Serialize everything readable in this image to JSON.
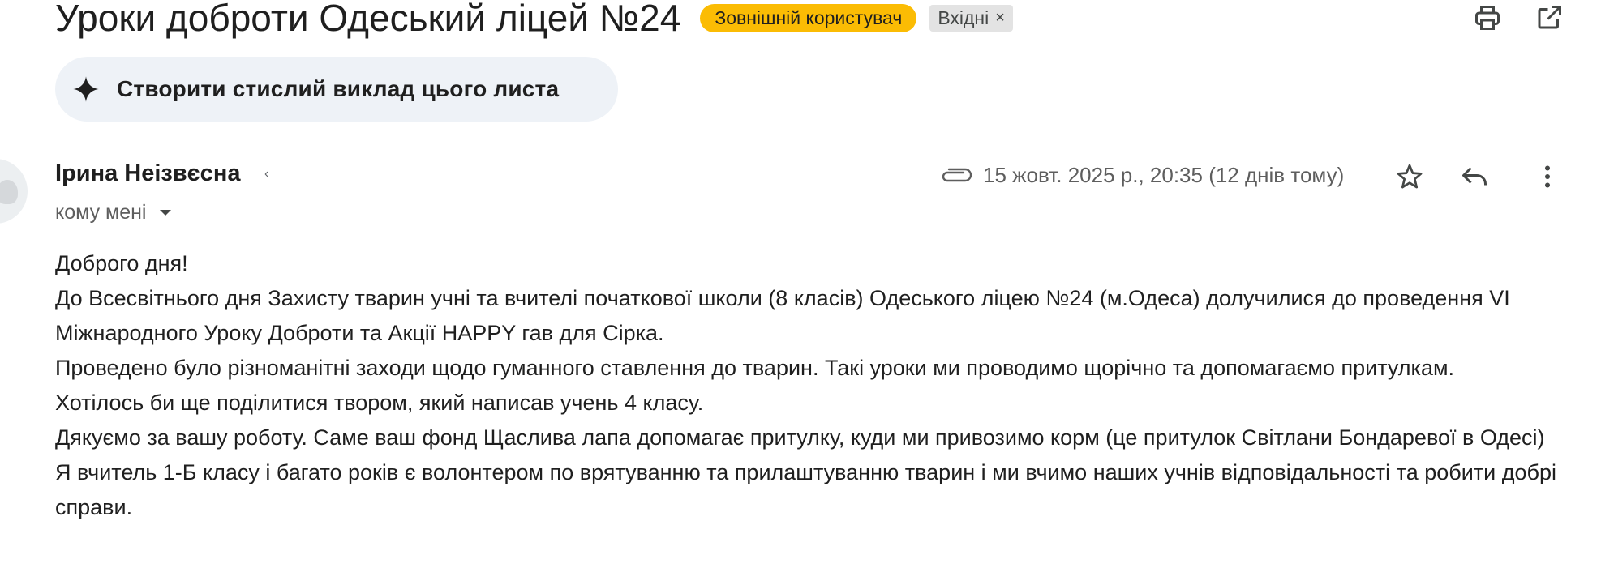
{
  "email": {
    "subject": "Уроки доброти Одеський ліцей №24",
    "external_badge": "Зовнішній користувач",
    "label_chip": "Вхідні",
    "label_chip_remove": "×",
    "summary_button_label": "Створити стислий виклад цього листа",
    "sender_name": "Ірина Неізвєсна",
    "sender_caret": "‹",
    "recipient_label": "кому мені",
    "date_text": "15 жовт. 2025 р., 20:35 (12 днів тому)",
    "body_paragraphs": [
      "Доброго дня!",
      "До Всесвітнього дня Захисту тварин учні та вчителі початкової школи (8 класів) Одеського ліцею №24 (м.Одеса)  долучилися до проведення VI Міжнародного Уроку Доброти та Акції HAPPY гав для Сірка.",
      "Проведено було різноманітні заходи щодо гуманного ставлення до тварин. Такі уроки ми проводимо щорічно та допомагаємо притулкам.",
      "Хотілось би ще поділитися твором, який написав учень 4 класу.",
      "Дякуємо за вашу роботу. Саме ваш фонд Щаслива лапа допомагає притулку, куди ми привозимо корм (це притулок Світлани Бондаревої в Одесі)",
      "Я вчитель 1-Б класу і  багато років є волонтером по врятуванню та прилаштуванню тварин і ми вчимо наших учнів відповідальності та робити добрі справи."
    ]
  },
  "icons": {
    "print": "print-icon",
    "open_new_window": "open-in-new-window-icon",
    "sparkle": "sparkle-icon",
    "attachment": "attachment-icon",
    "star": "star-icon",
    "reply": "reply-icon",
    "more": "more-vertical-icon",
    "dropdown": "chevron-down-icon"
  },
  "colors": {
    "external_badge_bg": "#fbbc04",
    "label_chip_bg": "#e3e3e3",
    "summary_button_bg": "#eef2f7",
    "text_primary": "#1f1f1f",
    "text_secondary": "#5e5e5e"
  }
}
